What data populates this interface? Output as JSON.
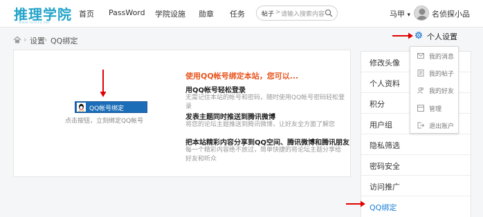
{
  "header": {
    "logo": "推理学院",
    "logo_sub": "www.tuilixy.net",
    "nav": [
      "首页",
      "PassWord",
      "学院设施",
      "勋章",
      "任务"
    ],
    "search": {
      "category": "帖子",
      "separator": ">",
      "placeholder": "请输入搜索内容"
    },
    "user_short": "马甲",
    "user_arrow": "▾",
    "username": "名侦探小品"
  },
  "breadcrumb": {
    "items": [
      "设置",
      "QQ绑定"
    ],
    "separator": "›"
  },
  "main": {
    "qq_button_label": "QQ帐号绑定",
    "qq_hint": "点击按钮，立刻绑定QQ帐号",
    "promo_title": "使用QQ帐号绑定本站，您可以...",
    "features": [
      {
        "title": "用QQ帐号轻松登录",
        "desc": "无需记住本站的帐号和密码，随时使用QQ帐号密码轻松登录"
      },
      {
        "title": "发表主题同时推送到腾讯微博",
        "desc": "将您的论坛主题推送到腾讯微博，让好友全方面了解您"
      },
      {
        "title": "把本站精彩内容分享到QQ空间、腾讯微博和腾讯朋友",
        "desc": "每一个精彩内容绝不放过，简单快捷的将论坛主题分享给好友和听众"
      }
    ]
  },
  "right_menu": {
    "items": [
      "修改头像",
      "个人资料",
      "积分",
      "用户组",
      "隐私筛选",
      "密码安全",
      "访问推广",
      "QQ绑定"
    ],
    "active_index": 7
  },
  "dropdown": {
    "header_label": "个人设置",
    "items": [
      {
        "label": "我的消息",
        "icon": "mail-icon"
      },
      {
        "label": "我的帖子",
        "icon": "post-icon"
      },
      {
        "label": "我的好友",
        "icon": "friends-icon"
      },
      {
        "label": "管理",
        "icon": "manage-icon"
      },
      {
        "label": "退出账户",
        "icon": "logout-icon"
      }
    ]
  },
  "colors": {
    "accent": "#22a3c9",
    "link": "#1a7fd4",
    "promo": "#e8541e",
    "qq_button": "#1c6db8",
    "arrow": "#e00000"
  }
}
